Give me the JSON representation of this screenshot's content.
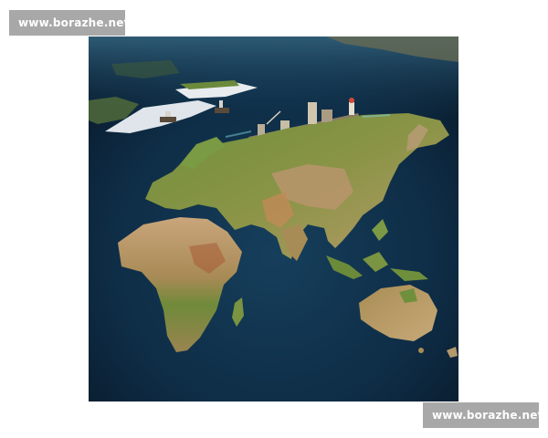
{
  "watermarks": {
    "top_left": "www.borazhe.net",
    "bottom_right": "www.borazhe.net"
  },
  "photo": {
    "subject": "world-map-diorama-icon",
    "colors": {
      "ocean_deep": "#0a1f33",
      "ocean_mid": "#123a55",
      "land_desert": "#b8916a",
      "land_green": "#6b8a3a",
      "ice": "#e8ecef"
    }
  }
}
